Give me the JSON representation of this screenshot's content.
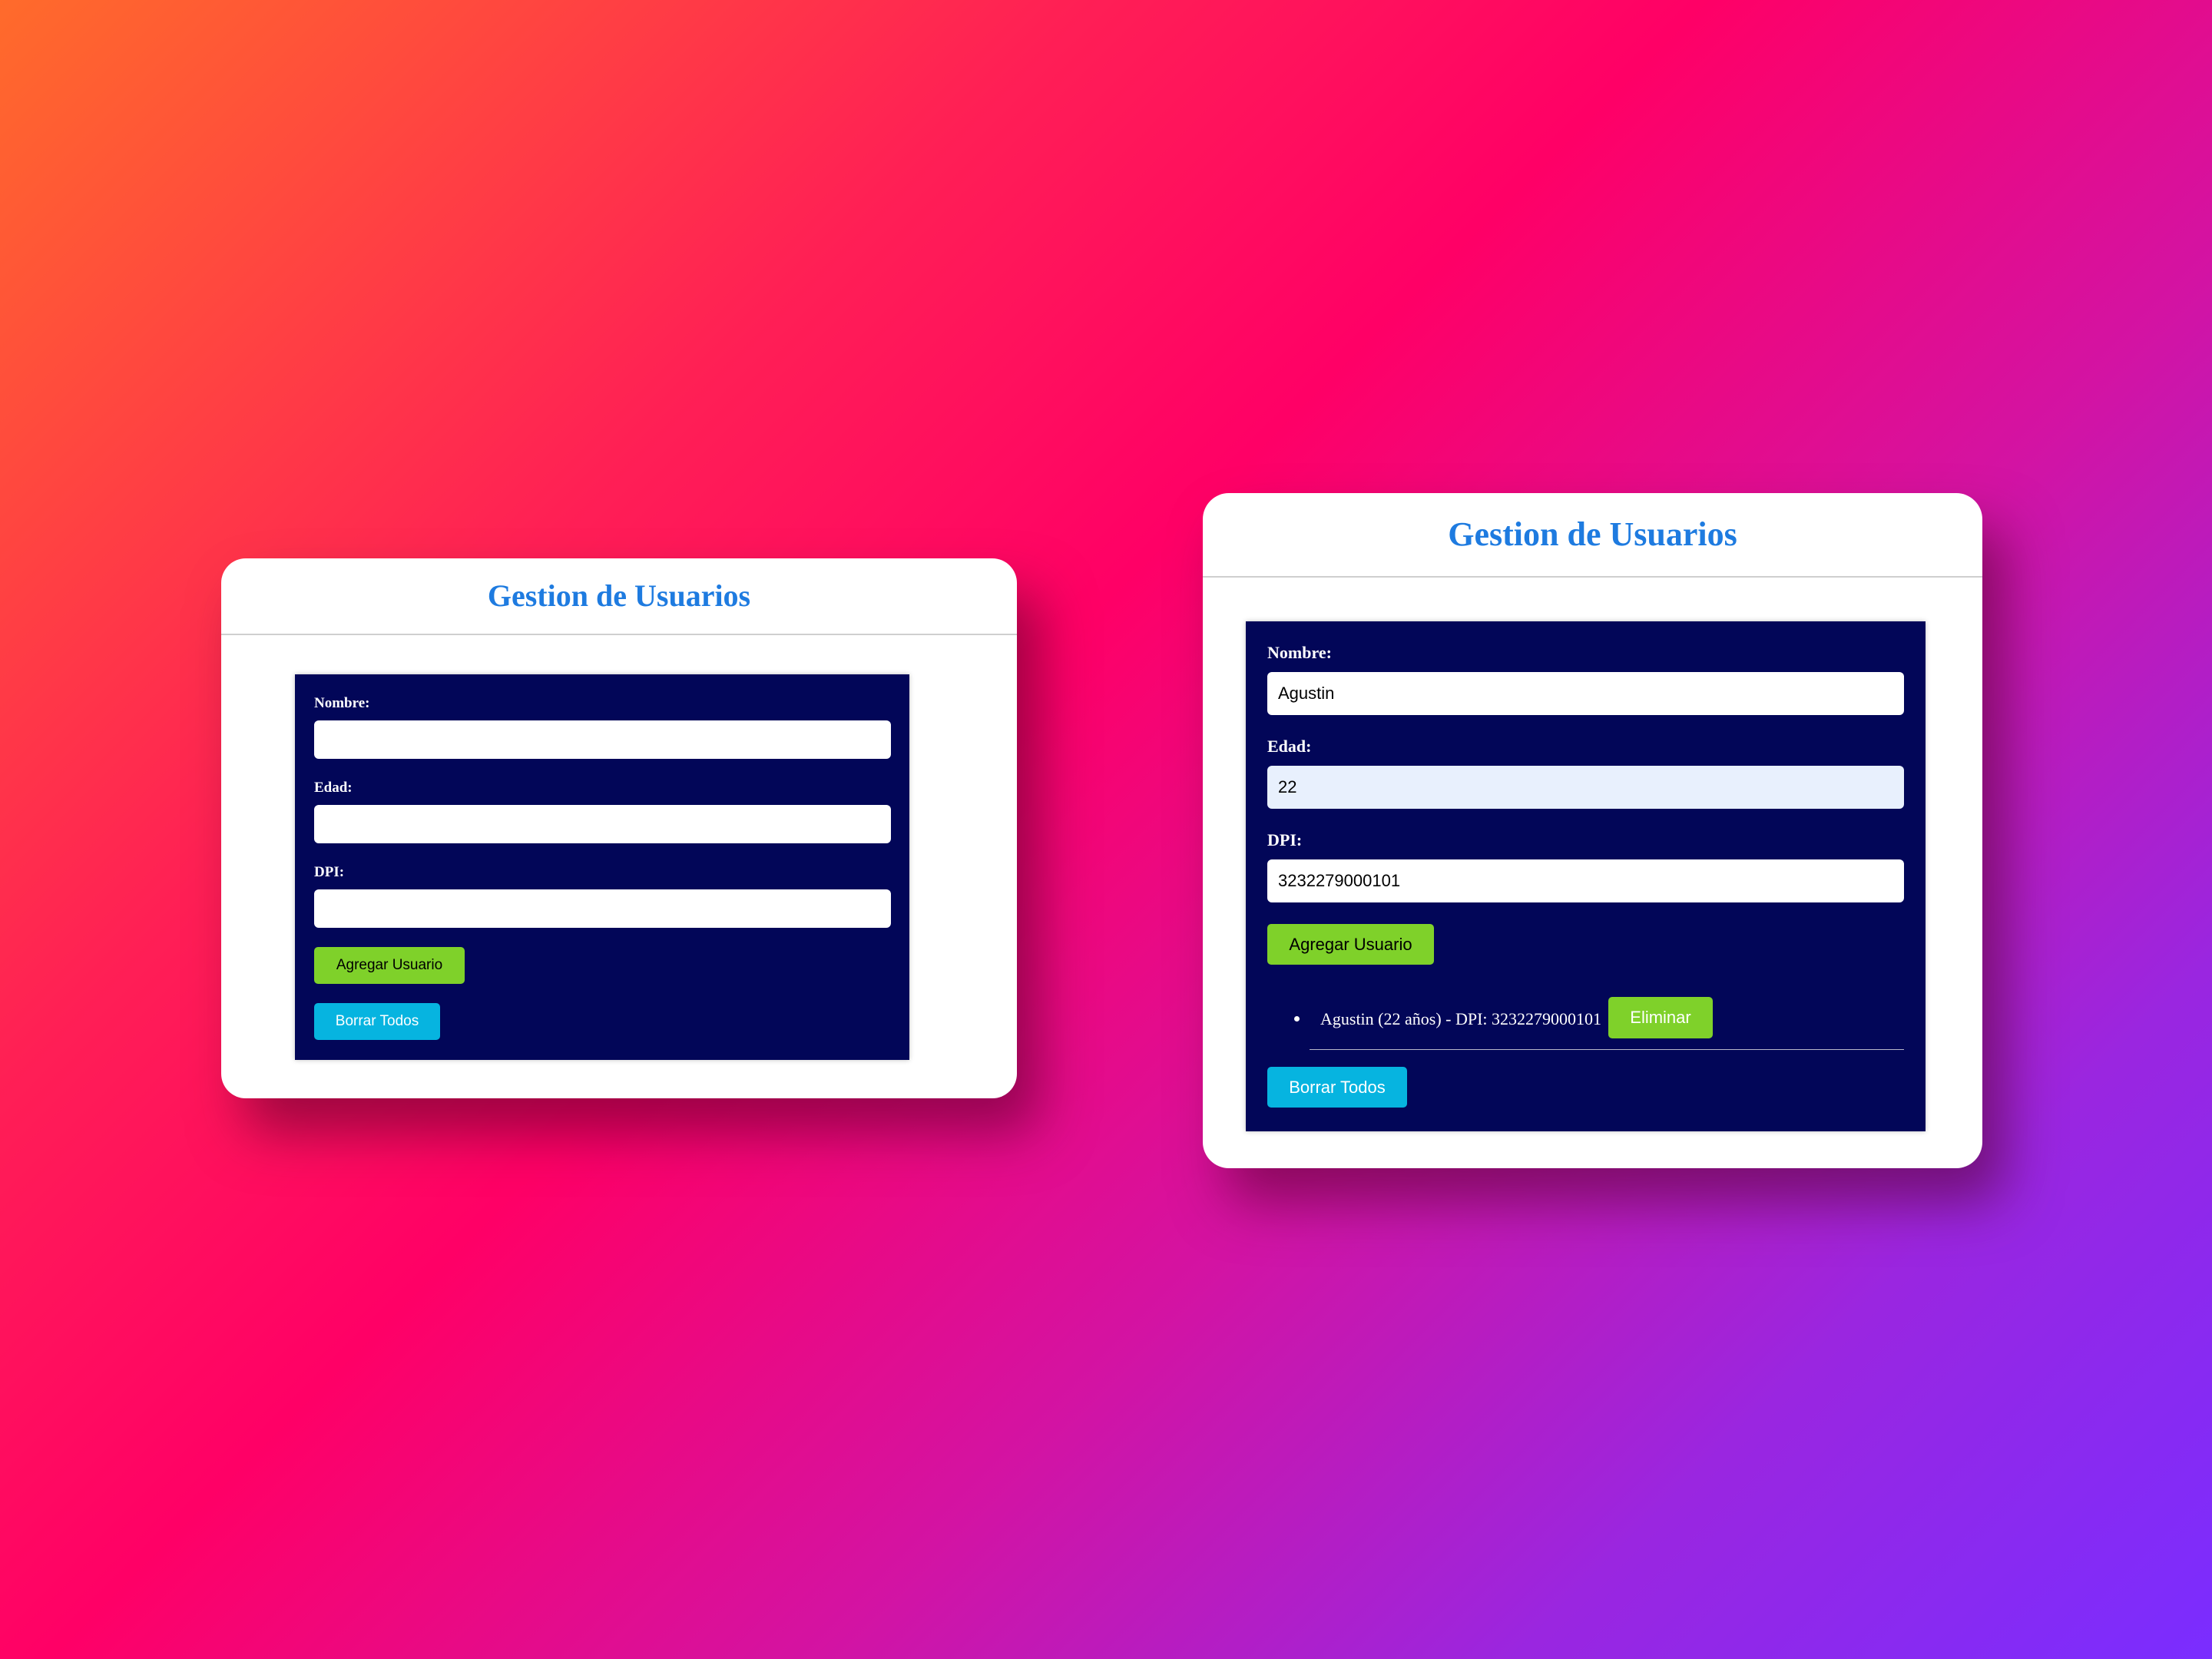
{
  "left_window": {
    "title": "Gestion de Usuarios",
    "form": {
      "nombre_label": "Nombre:",
      "nombre_value": "",
      "edad_label": "Edad:",
      "edad_value": "",
      "dpi_label": "DPI:",
      "dpi_value": "",
      "add_button": "Agregar Usuario",
      "clear_button": "Borrar Todos"
    }
  },
  "right_window": {
    "title": "Gestion de Usuarios",
    "form": {
      "nombre_label": "Nombre:",
      "nombre_value": "Agustin",
      "edad_label": "Edad:",
      "edad_value": "22",
      "dpi_label": "DPI:",
      "dpi_value": "3232279000101",
      "add_button": "Agregar Usuario",
      "clear_button": "Borrar Todos"
    },
    "users": [
      {
        "text": "Agustin (22 años) - DPI: 3232279000101",
        "delete_label": "Eliminar"
      }
    ]
  },
  "colors": {
    "title": "#1e7be0",
    "panel": "#020658",
    "add_button": "#7fd12a",
    "clear_button": "#06b4e0",
    "focused_input": "#e8f0fd"
  }
}
